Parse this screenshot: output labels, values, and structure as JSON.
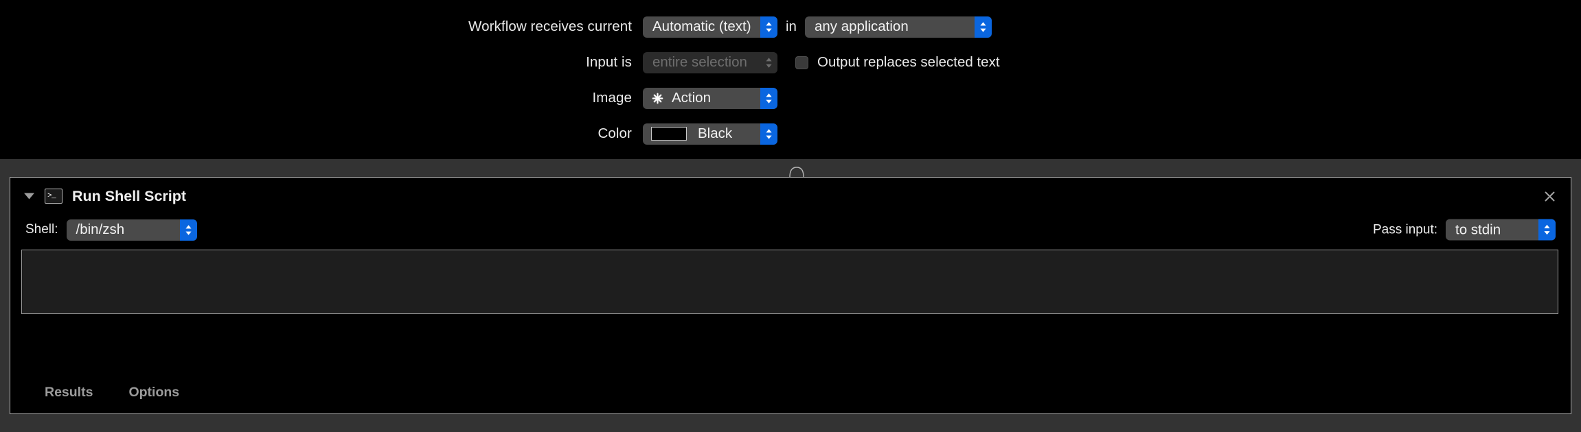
{
  "workflow_settings": {
    "receives": {
      "label": "Workflow receives current",
      "value": "Automatic (text)",
      "connector_word": "in",
      "application_value": "any application"
    },
    "input_is": {
      "label": "Input is",
      "value": "entire selection",
      "disabled": true
    },
    "output_replaces": {
      "label": "Output replaces selected text",
      "checked": false
    },
    "image": {
      "label": "Image",
      "value": "Action",
      "icon": "gear-icon"
    },
    "color": {
      "label": "Color",
      "value": "Black",
      "swatch_hex": "#000000"
    }
  },
  "action": {
    "title": "Run Shell Script",
    "icon": "terminal-icon",
    "terminal_prompt": ">_",
    "disclosure_state": "expanded",
    "close_label": "×",
    "shell": {
      "label": "Shell:",
      "value": "/bin/zsh"
    },
    "pass_input": {
      "label": "Pass input:",
      "value": "to stdin"
    },
    "script": {
      "value": "",
      "placeholder": ""
    },
    "footer_tabs": [
      {
        "label": "Results"
      },
      {
        "label": "Options"
      }
    ]
  },
  "colors": {
    "accent_blue": "#0a66e0",
    "canvas_grey": "#333333",
    "panel_black": "#000000",
    "panel_border": "#b6b6b6",
    "popup_fill": "#4a4a4a",
    "popup_disabled_fill": "#2b2b2b",
    "text_primary": "#e9e9e9",
    "text_disabled": "#6e6e6e",
    "footer_tab_text": "#9b9b9b"
  }
}
